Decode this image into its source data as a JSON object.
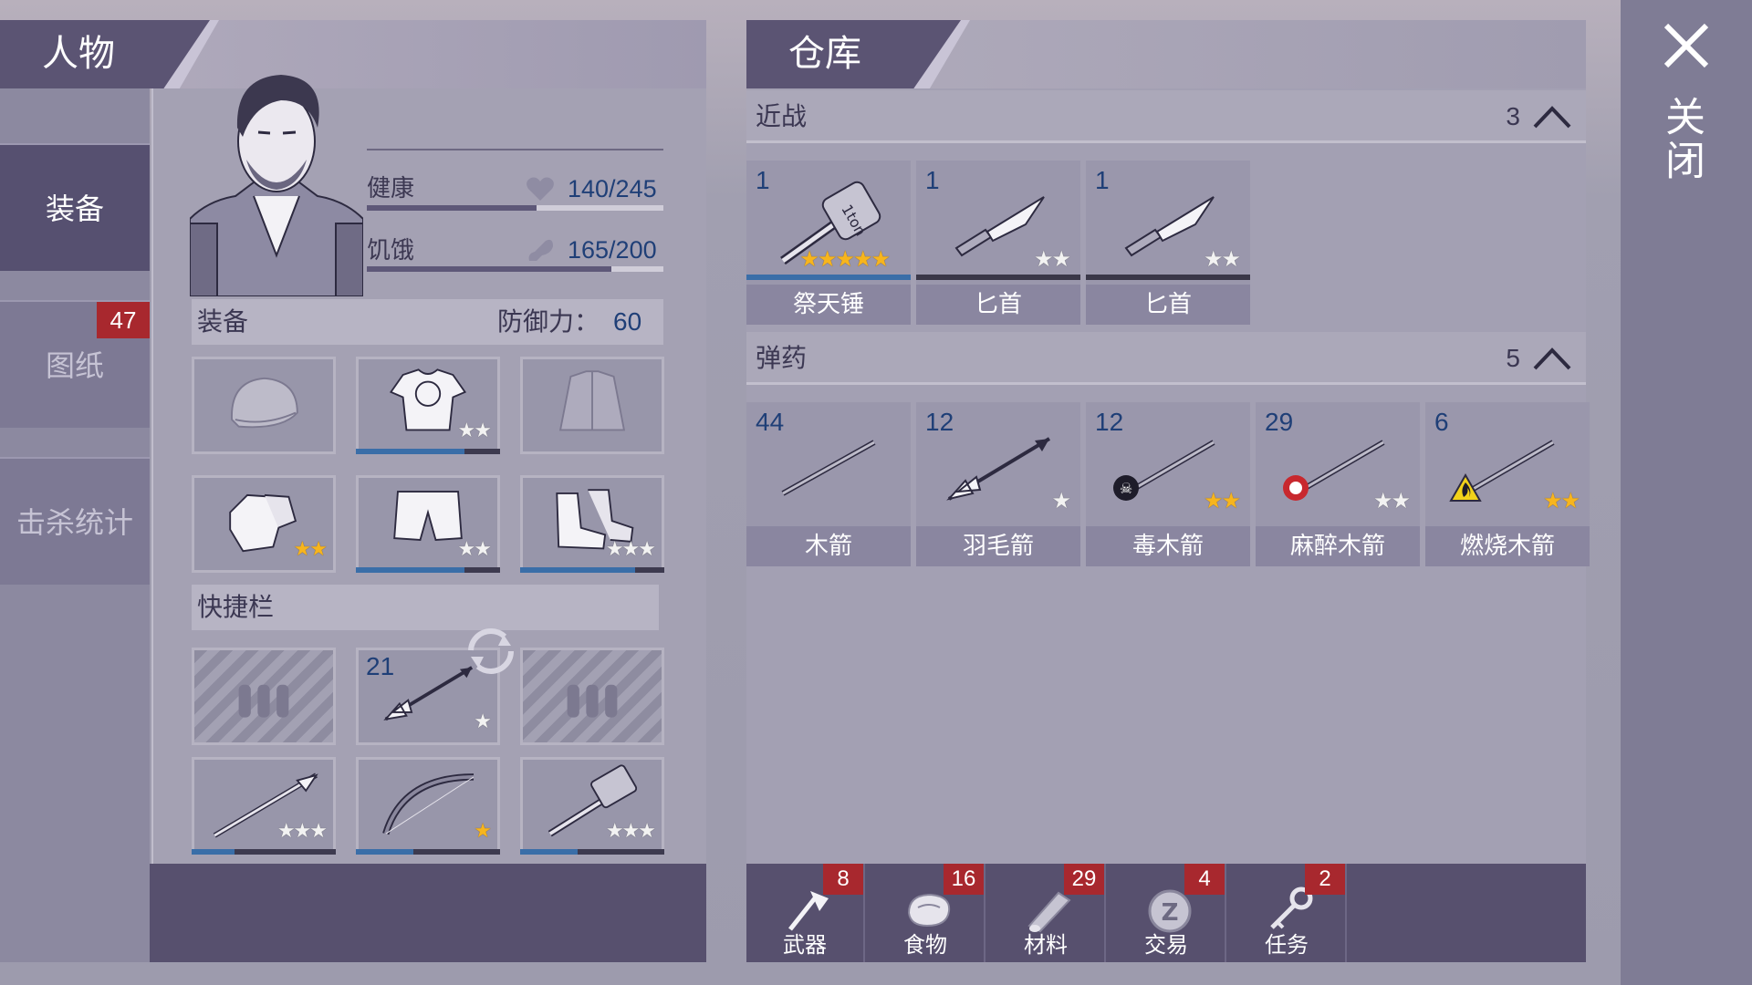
{
  "character_tab": {
    "title": "人物"
  },
  "sidebar": {
    "items": [
      {
        "label": "装备",
        "active": true
      },
      {
        "label": "图纸",
        "badge": "47"
      },
      {
        "label": "击杀统计"
      }
    ]
  },
  "stats": {
    "health": {
      "label": "健康",
      "value": "140/245",
      "fraction": 0.571
    },
    "hunger": {
      "label": "饥饿",
      "value": "165/200",
      "fraction": 0.825
    }
  },
  "equipment": {
    "title": "装备",
    "defense_label": "防御力：",
    "defense_value": "60",
    "slots": [
      {
        "icon": "beanie-icon",
        "stars": 0,
        "durability": null
      },
      {
        "icon": "shirt-icon",
        "stars": 2,
        "durability": 0.75
      },
      {
        "icon": "jacket-icon",
        "stars": 0,
        "durability": null
      },
      {
        "icon": "gloves-icon",
        "stars": 2,
        "durability": null,
        "gold": true
      },
      {
        "icon": "shorts-icon",
        "stars": 2,
        "durability": 0.75
      },
      {
        "icon": "boots-icon",
        "stars": 3,
        "durability": 0.8
      }
    ]
  },
  "quickbar": {
    "title": "快捷栏",
    "slots": [
      {
        "locked": true,
        "icon": "bullets-icon"
      },
      {
        "locked": false,
        "icon": "feather-arrow-icon",
        "quantity": "21",
        "stars": 1
      },
      {
        "locked": true,
        "icon": "bullets-icon"
      },
      {
        "locked": false,
        "icon": "spear-icon",
        "stars": 3,
        "durability": 0.3
      },
      {
        "locked": false,
        "icon": "bow-icon",
        "stars": 1,
        "gold": true,
        "durability": 0.4
      },
      {
        "locked": false,
        "icon": "hammer-icon",
        "stars": 3,
        "durability": 0.4
      }
    ]
  },
  "storage": {
    "title": "仓库",
    "melee": {
      "label": "近战",
      "count": "3",
      "items": [
        {
          "name": "祭天锤",
          "quantity": "1",
          "icon": "sledgehammer-icon",
          "stars": 5,
          "gold": true,
          "durability": 1.0,
          "hammer_text": "1ton"
        },
        {
          "name": "匕首",
          "quantity": "1",
          "icon": "dagger-icon",
          "stars": 2,
          "durability": 0
        },
        {
          "name": "匕首",
          "quantity": "1",
          "icon": "dagger-icon",
          "stars": 2,
          "durability": 0
        }
      ]
    },
    "ammo": {
      "label": "弹药",
      "count": "5",
      "items": [
        {
          "name": "木箭",
          "quantity": "44",
          "icon": "wood-arrow-icon",
          "stars": 0
        },
        {
          "name": "羽毛箭",
          "quantity": "12",
          "icon": "feather-arrow-icon",
          "stars": 1
        },
        {
          "name": "毒木箭",
          "quantity": "12",
          "icon": "poison-arrow-icon",
          "stars": 2,
          "gold": true
        },
        {
          "name": "麻醉木箭",
          "quantity": "29",
          "icon": "sleep-arrow-icon",
          "stars": 2
        },
        {
          "name": "燃烧木箭",
          "quantity": "6",
          "icon": "fire-arrow-icon",
          "stars": 2,
          "gold": true
        }
      ]
    }
  },
  "bottom_tabs": [
    {
      "label": "武器",
      "badge": "8",
      "icon": "axe-icon"
    },
    {
      "label": "食物",
      "badge": "16",
      "icon": "meat-icon"
    },
    {
      "label": "材料",
      "badge": "29",
      "icon": "log-icon"
    },
    {
      "label": "交易",
      "badge": "4",
      "icon": "coin-icon"
    },
    {
      "label": "任务",
      "badge": "2",
      "icon": "key-icon"
    }
  ],
  "close": {
    "label": "关闭"
  },
  "colors": {
    "accent": "#3a6ea8",
    "badge": "#a8282e",
    "panel_dark": "#57506e",
    "star_gold": "#f7b51d"
  }
}
